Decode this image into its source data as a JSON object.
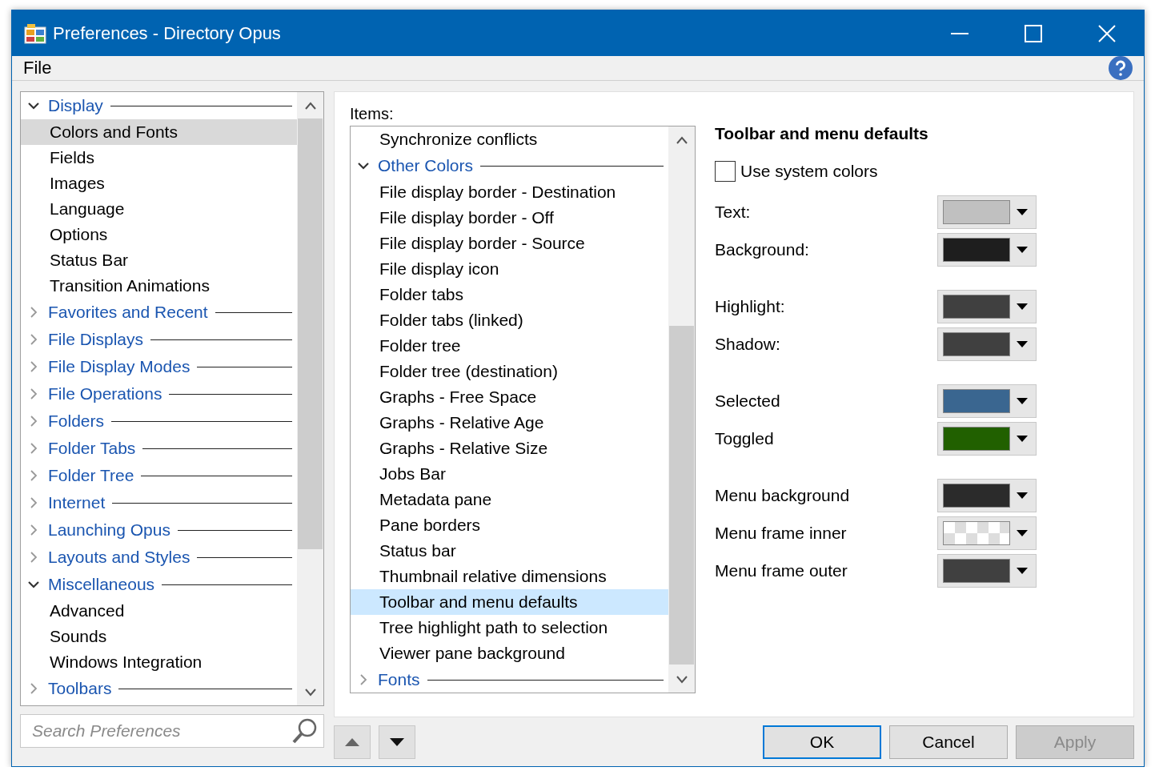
{
  "window": {
    "title": "Preferences - Directory Opus"
  },
  "menu": [
    "File"
  ],
  "tree": [
    {
      "label": "Display",
      "kind": "category",
      "expanded": true,
      "selected": false,
      "children": [
        {
          "label": "Colors and Fonts",
          "kind": "page",
          "selected": true
        },
        {
          "label": "Fields",
          "kind": "page",
          "selected": false
        },
        {
          "label": "Images",
          "kind": "page",
          "selected": false
        },
        {
          "label": "Language",
          "kind": "page",
          "selected": false
        },
        {
          "label": "Options",
          "kind": "page",
          "selected": false
        },
        {
          "label": "Status Bar",
          "kind": "page",
          "selected": false
        },
        {
          "label": "Transition Animations",
          "kind": "page",
          "selected": false
        }
      ]
    },
    {
      "label": "Favorites and Recent",
      "kind": "category",
      "expanded": false,
      "selected": false
    },
    {
      "label": "File Displays",
      "kind": "category",
      "expanded": false,
      "selected": false
    },
    {
      "label": "File Display Modes",
      "kind": "category",
      "expanded": false,
      "selected": false
    },
    {
      "label": "File Operations",
      "kind": "category",
      "expanded": false,
      "selected": false
    },
    {
      "label": "Folders",
      "kind": "category",
      "expanded": false,
      "selected": false
    },
    {
      "label": "Folder Tabs",
      "kind": "category",
      "expanded": false,
      "selected": false
    },
    {
      "label": "Folder Tree",
      "kind": "category",
      "expanded": false,
      "selected": false
    },
    {
      "label": "Internet",
      "kind": "category",
      "expanded": false,
      "selected": false
    },
    {
      "label": "Launching Opus",
      "kind": "category",
      "expanded": false,
      "selected": false
    },
    {
      "label": "Layouts and Styles",
      "kind": "category",
      "expanded": false,
      "selected": false
    },
    {
      "label": "Miscellaneous",
      "kind": "category",
      "expanded": true,
      "selected": false,
      "children": [
        {
          "label": "Advanced",
          "kind": "page",
          "selected": false
        },
        {
          "label": "Sounds",
          "kind": "page",
          "selected": false
        },
        {
          "label": "Windows Integration",
          "kind": "page",
          "selected": false
        }
      ]
    },
    {
      "label": "Toolbars",
      "kind": "category",
      "expanded": false,
      "selected": false
    }
  ],
  "search": {
    "placeholder": "Search Preferences"
  },
  "items": {
    "label": "Items:",
    "list": [
      {
        "label": "Synchronize conflicts",
        "kind": "item",
        "selected": false
      },
      {
        "label": "Other Colors",
        "kind": "category",
        "expanded": true,
        "selected": false,
        "children": [
          {
            "label": "File display border - Destination",
            "kind": "item",
            "selected": false
          },
          {
            "label": "File display border - Off",
            "kind": "item",
            "selected": false
          },
          {
            "label": "File display border - Source",
            "kind": "item",
            "selected": false
          },
          {
            "label": "File display icon",
            "kind": "item",
            "selected": false
          },
          {
            "label": "Folder tabs",
            "kind": "item",
            "selected": false
          },
          {
            "label": "Folder tabs (linked)",
            "kind": "item",
            "selected": false
          },
          {
            "label": "Folder tree",
            "kind": "item",
            "selected": false
          },
          {
            "label": "Folder tree (destination)",
            "kind": "item",
            "selected": false
          },
          {
            "label": "Graphs - Free Space",
            "kind": "item",
            "selected": false
          },
          {
            "label": "Graphs - Relative Age",
            "kind": "item",
            "selected": false
          },
          {
            "label": "Graphs - Relative Size",
            "kind": "item",
            "selected": false
          },
          {
            "label": "Jobs Bar",
            "kind": "item",
            "selected": false
          },
          {
            "label": "Metadata pane",
            "kind": "item",
            "selected": false
          },
          {
            "label": "Pane borders",
            "kind": "item",
            "selected": false
          },
          {
            "label": "Status bar",
            "kind": "item",
            "selected": false
          },
          {
            "label": "Thumbnail relative dimensions",
            "kind": "item",
            "selected": false
          },
          {
            "label": "Toolbar and menu defaults",
            "kind": "item",
            "selected": true
          },
          {
            "label": "Tree highlight path to selection",
            "kind": "item",
            "selected": false
          },
          {
            "label": "Viewer pane background",
            "kind": "item",
            "selected": false
          }
        ]
      },
      {
        "label": "Fonts",
        "kind": "category",
        "expanded": false,
        "selected": false
      }
    ]
  },
  "settings": {
    "title": "Toolbar and menu defaults",
    "use_system_colors": {
      "label": "Use system colors",
      "checked": false
    },
    "groups": [
      {
        "rows": [
          {
            "label": "Text:",
            "kind": "solid",
            "color": "#c0c0c0"
          },
          {
            "label": "Background:",
            "kind": "solid",
            "color": "#1e1e1e"
          }
        ]
      },
      {
        "rows": [
          {
            "label": "Highlight:",
            "kind": "solid",
            "color": "#404040"
          },
          {
            "label": "Shadow:",
            "kind": "solid",
            "color": "#404040"
          }
        ]
      },
      {
        "rows": [
          {
            "label": "Selected",
            "kind": "solid",
            "color": "#3a6690"
          },
          {
            "label": "Toggled",
            "kind": "solid",
            "color": "#216000"
          }
        ]
      },
      {
        "rows": [
          {
            "label": "Menu background",
            "kind": "solid",
            "color": "#2b2b2b"
          },
          {
            "label": "Menu frame inner",
            "kind": "transparent"
          },
          {
            "label": "Menu frame outer",
            "kind": "solid",
            "color": "#404040"
          }
        ]
      }
    ]
  },
  "buttons": [
    {
      "label": "OK",
      "default": true,
      "disabled": false
    },
    {
      "label": "Cancel",
      "default": false,
      "disabled": false
    },
    {
      "label": "Apply",
      "default": false,
      "disabled": true
    }
  ]
}
